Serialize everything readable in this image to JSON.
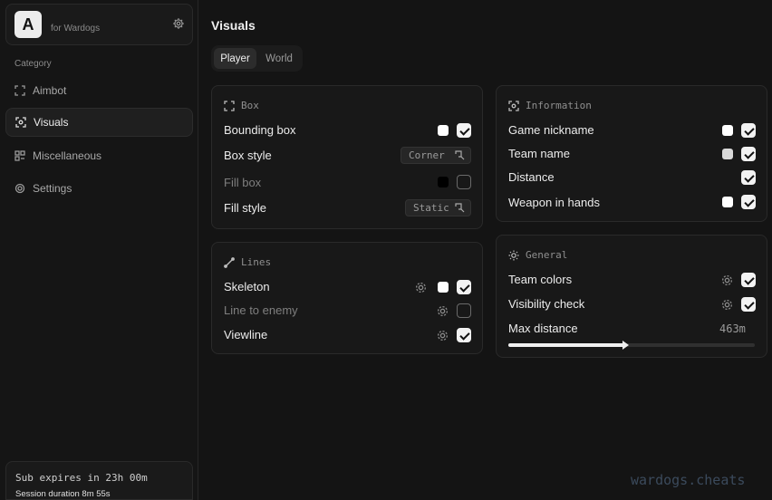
{
  "brand": {
    "logo_letter": "A",
    "subtitle": "for Wardogs",
    "settings_icon": "gear-icon"
  },
  "sidebar": {
    "category_label": "Category",
    "items": [
      {
        "label": "Aimbot",
        "icon": "crosshair-icon",
        "active": false
      },
      {
        "label": "Visuals",
        "icon": "scan-eye-icon",
        "active": true
      },
      {
        "label": "Miscellaneous",
        "icon": "grid-icon",
        "active": false
      },
      {
        "label": "Settings",
        "icon": "gear-icon",
        "active": false
      }
    ],
    "subscription": {
      "expires": "Sub expires in 23h 00m",
      "session": "Session duration  8m 55s"
    }
  },
  "main": {
    "title": "Visuals",
    "tabs": [
      {
        "label": "Player",
        "active": true
      },
      {
        "label": "World",
        "active": false
      }
    ]
  },
  "box": {
    "title": "Box",
    "rows": [
      {
        "label": "Bounding box",
        "color": "#ffffff",
        "checked": true
      },
      {
        "label": "Box style",
        "value": "Corner"
      },
      {
        "label": "Fill box",
        "color": "#000000",
        "checked": false
      },
      {
        "label": "Fill style",
        "value": "Static"
      }
    ]
  },
  "lines": {
    "title": "Lines",
    "rows": [
      {
        "label": "Skeleton",
        "color": "#ffffff",
        "checked": true
      },
      {
        "label": "Line to enemy",
        "checked": false
      },
      {
        "label": "Viewline",
        "checked": true
      }
    ]
  },
  "information": {
    "title": "Information",
    "rows": [
      {
        "label": "Game nickname",
        "color": "#ffffff",
        "checked": true
      },
      {
        "label": "Team name",
        "color": "#d9d9d9",
        "checked": true
      },
      {
        "label": "Distance",
        "checked": true
      },
      {
        "label": "Weapon in hands",
        "color": "#ffffff",
        "checked": true
      }
    ]
  },
  "general": {
    "title": "General",
    "rows": [
      {
        "label": "Team colors",
        "checked": true
      },
      {
        "label": "Visibility check",
        "checked": true
      },
      {
        "label": "Max distance",
        "value": "463m",
        "fraction": 0.47
      }
    ]
  },
  "watermark": "wardogs.cheats"
}
